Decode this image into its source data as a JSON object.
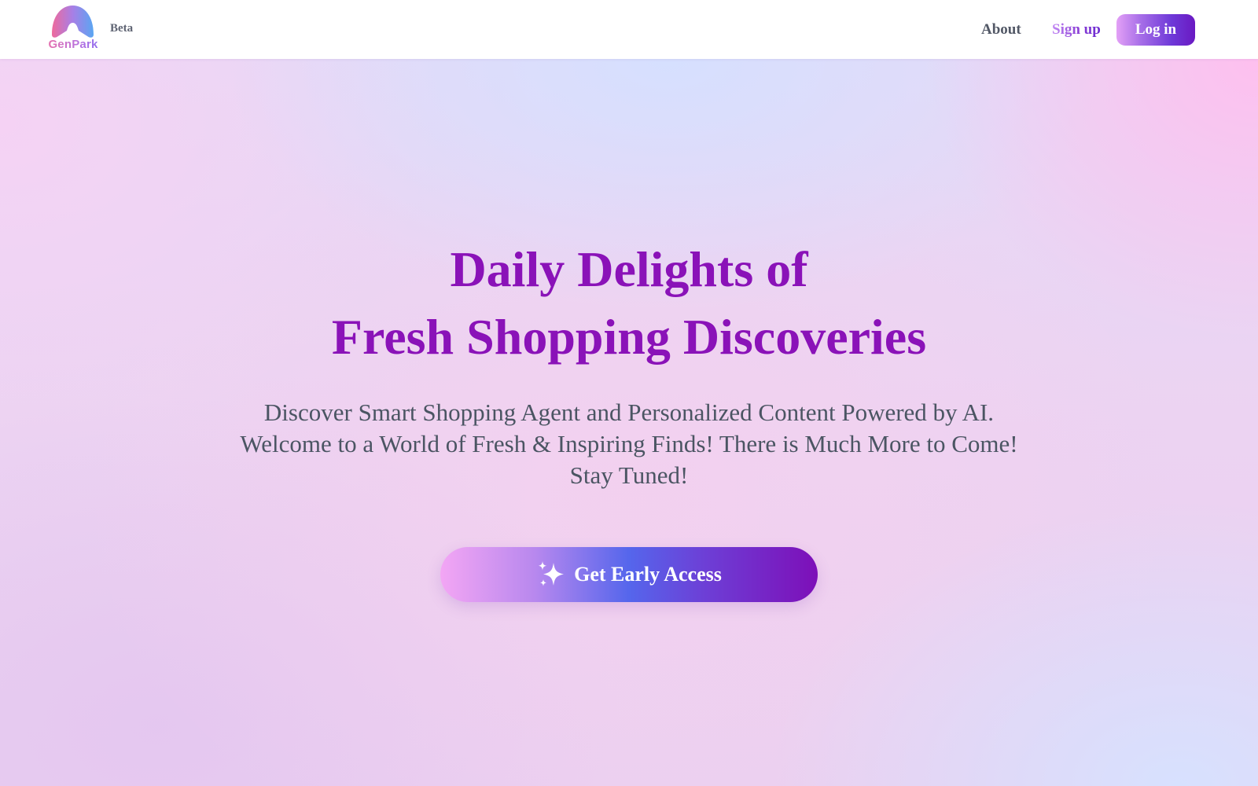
{
  "header": {
    "logo": {
      "icon": "genpark-logo-icon",
      "wordmark": "GenPark"
    },
    "badge": "Beta",
    "nav": {
      "about": "About",
      "signup": "Sign up",
      "login": "Log in"
    }
  },
  "hero": {
    "headline_line1": "Daily Delights of",
    "headline_line2": "Fresh Shopping Discoveries",
    "subtext_line1": "Discover Smart Shopping Agent and Personalized Content Powered by AI.",
    "subtext_line2": "Welcome to a World of Fresh & Inspiring Finds! There is Much More to Come!",
    "subtext_line3": "Stay Tuned!",
    "cta_label": "Get Early Access",
    "cta_icon": "sparkle-icon"
  },
  "colors": {
    "headline": "#8a12b8",
    "body_text": "#4b5563",
    "nav_text": "#525866",
    "accent_purple": "#6a19c2",
    "accent_blue": "#5566ec",
    "accent_pink": "#f3a6f4"
  }
}
